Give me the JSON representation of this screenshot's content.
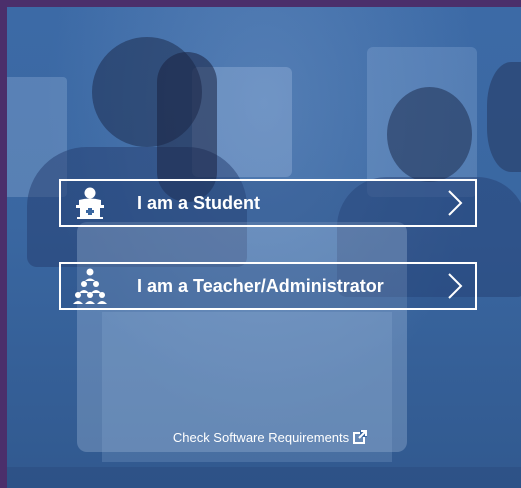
{
  "buttons": {
    "student": {
      "label": "I am a Student",
      "icon": "student-icon"
    },
    "teacher": {
      "label": "I am a Teacher/Administrator",
      "icon": "teacher-group-icon"
    }
  },
  "links": {
    "software_requirements": {
      "label": "Check Software Requirements",
      "icon": "external-link-icon"
    }
  },
  "colors": {
    "frame": "#4b2f6b",
    "overlay": "#3a67a1",
    "text": "#ffffff"
  }
}
